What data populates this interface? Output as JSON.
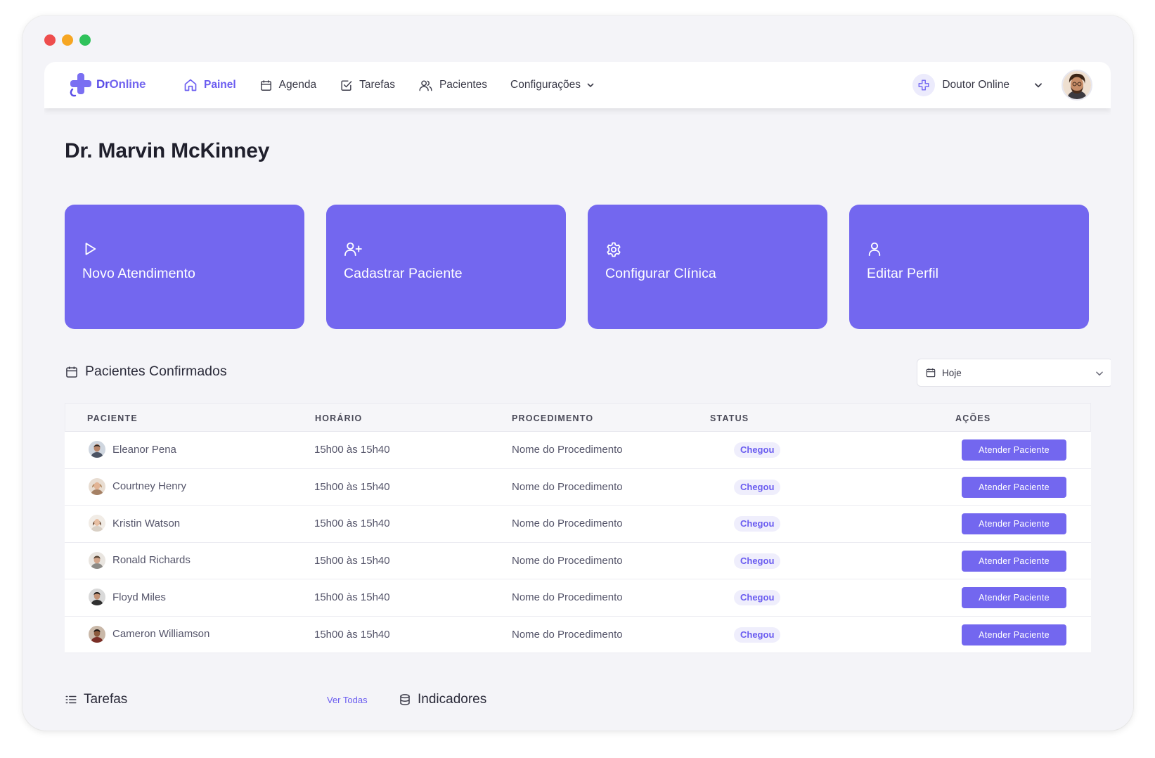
{
  "nav": {
    "logo_prefix": "Dr",
    "logo_suffix": "Online",
    "items": [
      {
        "label": "Painel",
        "icon": "home-icon",
        "active": true
      },
      {
        "label": "Agenda",
        "icon": "calendar-icon",
        "active": false
      },
      {
        "label": "Tarefas",
        "icon": "checkbox-icon",
        "active": false
      },
      {
        "label": "Pacientes",
        "icon": "users-icon",
        "active": false
      },
      {
        "label": "Configurações",
        "icon": "chevron-down-icon",
        "active": false
      }
    ],
    "user_name": "Doutor Online"
  },
  "page": {
    "title": "Dr. Marvin McKinney"
  },
  "actions": [
    {
      "label": "Novo Atendimento",
      "icon": "play-icon"
    },
    {
      "label": "Cadastrar Paciente",
      "icon": "user-plus-icon"
    },
    {
      "label": "Configurar Clínica",
      "icon": "gear-icon"
    },
    {
      "label": "Editar Perfil",
      "icon": "user-icon"
    }
  ],
  "confirmed": {
    "title": "Pacientes Confirmados",
    "date_filter": "Hoje",
    "columns": [
      "PACIENTE",
      "HORÁRIO",
      "PROCEDIMENTO",
      "STATUS",
      "AÇÕES"
    ],
    "rows": [
      {
        "name": "Eleanor Pena",
        "time": "15h00 às 15h40",
        "procedure": "Nome do Procedimento",
        "status": "Chegou",
        "action": "Atender Paciente"
      },
      {
        "name": "Courtney Henry",
        "time": "15h00 às 15h40",
        "procedure": "Nome do Procedimento",
        "status": "Chegou",
        "action": "Atender Paciente"
      },
      {
        "name": "Kristin Watson",
        "time": "15h00 às 15h40",
        "procedure": "Nome do Procedimento",
        "status": "Chegou",
        "action": "Atender Paciente"
      },
      {
        "name": "Ronald Richards",
        "time": "15h00 às 15h40",
        "procedure": "Nome do Procedimento",
        "status": "Chegou",
        "action": "Atender Paciente"
      },
      {
        "name": "Floyd Miles",
        "time": "15h00 às 15h40",
        "procedure": "Nome do Procedimento",
        "status": "Chegou",
        "action": "Atender Paciente"
      },
      {
        "name": "Cameron Williamson",
        "time": "15h00 às 15h40",
        "procedure": "Nome do Procedimento",
        "status": "Chegou",
        "action": "Atender Paciente"
      }
    ]
  },
  "below_fold": {
    "tasks_title": "Tarefas",
    "see_all": "Ver Todas",
    "indicators_title": "Indicadores"
  },
  "colors": {
    "accent": "#7367ef",
    "accent_dark": "#6a5cf0",
    "background": "#f4f4f8"
  }
}
